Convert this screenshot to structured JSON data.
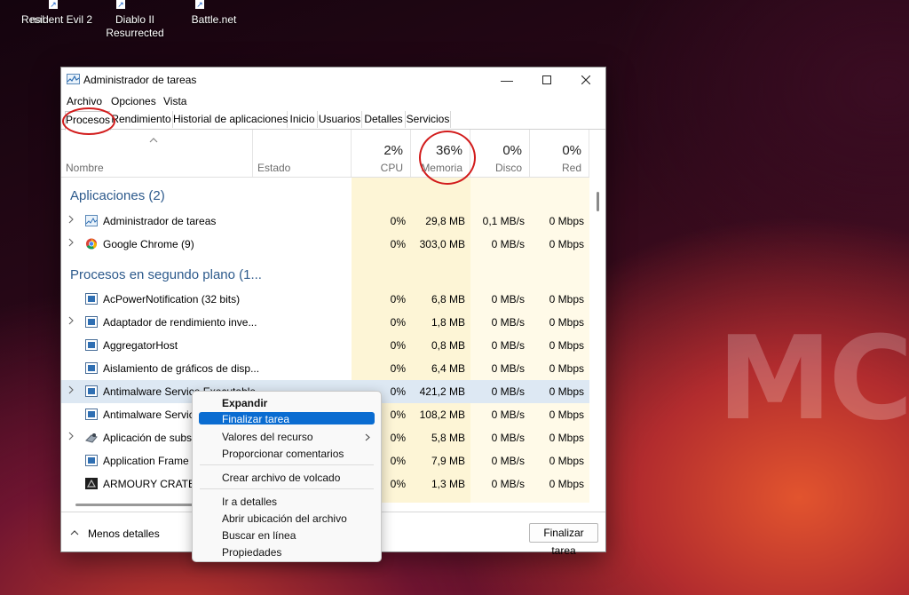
{
  "desktop": {
    "icons": [
      {
        "label": "nal"
      },
      {
        "label": "Resident Evil 2"
      },
      {
        "label": "Diablo II Resurrected"
      },
      {
        "label": "Battle.net"
      }
    ],
    "watermark": "MC"
  },
  "window": {
    "title": "Administrador de tareas",
    "menu": [
      "Archivo",
      "Opciones",
      "Vista"
    ],
    "tabs": [
      "Procesos",
      "Rendimiento",
      "Historial de aplicaciones",
      "Inicio",
      "Usuarios",
      "Detalles",
      "Servicios"
    ],
    "columns": {
      "name": "Nombre",
      "status": "Estado",
      "cpu": {
        "pct": "2%",
        "label": "CPU"
      },
      "memory": {
        "pct": "36%",
        "label": "Memoria"
      },
      "disk": {
        "pct": "0%",
        "label": "Disco"
      },
      "network": {
        "pct": "0%",
        "label": "Red"
      }
    },
    "groups": {
      "apps": "Aplicaciones (2)",
      "background": "Procesos en segundo plano (1..."
    },
    "rows": [
      {
        "name": "Administrador de tareas",
        "cpu": "0%",
        "mem": "29,8 MB",
        "disk": "0,1 MB/s",
        "net": "0 Mbps"
      },
      {
        "name": "Google Chrome (9)",
        "cpu": "0%",
        "mem": "303,0 MB",
        "disk": "0 MB/s",
        "net": "0 Mbps"
      },
      {
        "name": "AcPowerNotification (32 bits)",
        "cpu": "0%",
        "mem": "6,8 MB",
        "disk": "0 MB/s",
        "net": "0 Mbps"
      },
      {
        "name": "Adaptador de rendimiento inve...",
        "cpu": "0%",
        "mem": "1,8 MB",
        "disk": "0 MB/s",
        "net": "0 Mbps"
      },
      {
        "name": "AggregatorHost",
        "cpu": "0%",
        "mem": "0,8 MB",
        "disk": "0 MB/s",
        "net": "0 Mbps"
      },
      {
        "name": "Aislamiento de gráficos de disp...",
        "cpu": "0%",
        "mem": "6,4 MB",
        "disk": "0 MB/s",
        "net": "0 Mbps"
      },
      {
        "name": "Antimalware Service Executable",
        "cpu": "0%",
        "mem": "421,2 MB",
        "disk": "0 MB/s",
        "net": "0 Mbps"
      },
      {
        "name": "Antimalware Service",
        "cpu": "0%",
        "mem": "108,2 MB",
        "disk": "0 MB/s",
        "net": "0 Mbps"
      },
      {
        "name": "Aplicación de subsist",
        "cpu": "0%",
        "mem": "5,8 MB",
        "disk": "0 MB/s",
        "net": "0 Mbps"
      },
      {
        "name": "Application Frame H",
        "cpu": "0%",
        "mem": "7,9 MB",
        "disk": "0 MB/s",
        "net": "0 Mbps"
      },
      {
        "name": "ARMOURY CRATE De",
        "cpu": "0%",
        "mem": "1,3 MB",
        "disk": "0 MB/s",
        "net": "0 Mbps"
      }
    ],
    "footer": {
      "less_details": "Menos detalles",
      "end_task": "Finalizar tarea"
    }
  },
  "context_menu": {
    "items": [
      "Expandir",
      "Finalizar tarea",
      "Valores del recurso",
      "Proporcionar comentarios",
      "Crear archivo de volcado",
      "Ir a detalles",
      "Abrir ubicación del archivo",
      "Buscar en línea",
      "Propiedades"
    ]
  },
  "colors": {
    "accent": "#0a6cd1",
    "annotation": "#d21c1c",
    "group_text": "#2d5a8c",
    "column_tint": "#fdf5d6"
  }
}
